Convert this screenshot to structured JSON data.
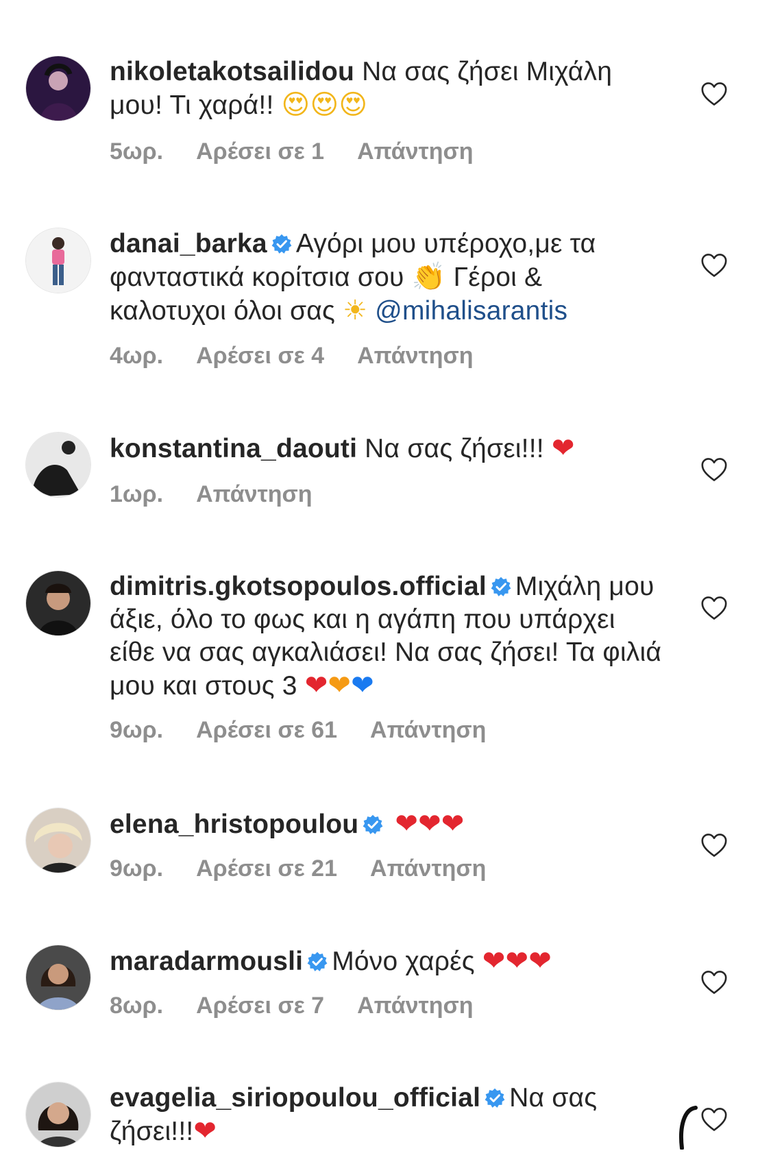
{
  "comments": [
    {
      "username": "nikoletakotsailidou",
      "verified": false,
      "text": " Να σας ζήσει Μιχάλη μου! Τι χαρά!! ",
      "emojis": "😍😍😍",
      "time": "5ωρ.",
      "likes": "Αρέσει σε 1",
      "reply": "Απάντηση"
    },
    {
      "username": "danai_barka",
      "verified": true,
      "text": "Αγόρι μου υπέροχο,με τα φανταστικά κορίτσια σου ",
      "emoji_clap": "👏",
      "text2": " Γέροι & καλοτυχοι όλοι σας ",
      "emoji_sun": "☀",
      "mention": " @mihalisarantis",
      "time": "4ωρ.",
      "likes": "Αρέσει σε 4",
      "reply": "Απάντηση"
    },
    {
      "username": "konstantina_daouti",
      "verified": false,
      "text": " Να σας ζήσει!!! ",
      "emojis": "❤",
      "time": "1ωρ.",
      "reply": "Απάντηση"
    },
    {
      "username": "dimitris.gkotsopoulos.official",
      "verified": true,
      "text": "Μιχάλη μου άξιε, όλο το φως και η αγάπη που υπάρχει είθε να σας αγκαλιάσει! Να σας ζήσει! Τα φιλιά μου και στους 3 ",
      "emoji_red": "❤",
      "emoji_orange": "❤",
      "emoji_blue": "❤",
      "time": "9ωρ.",
      "likes": "Αρέσει σε 61",
      "reply": "Απάντηση"
    },
    {
      "username": "elena_hristopoulou",
      "verified": true,
      "text": " ",
      "emojis": "❤❤❤",
      "time": "9ωρ.",
      "likes": "Αρέσει σε 21",
      "reply": "Απάντηση"
    },
    {
      "username": "maradarmousli",
      "verified": true,
      "text": "Μόνο χαρές ",
      "emojis": "❤❤❤",
      "time": "8ωρ.",
      "likes": "Αρέσει σε 7",
      "reply": "Απάντηση"
    },
    {
      "username": "evagelia_siriopoulou_official",
      "verified": true,
      "text": "Να σας ζήσει!!!",
      "emojis": "❤"
    }
  ],
  "icons": {
    "like": "heart-outline-icon",
    "verified": "verified-badge-icon"
  },
  "colors": {
    "text": "#262626",
    "meta": "#8e8e8e",
    "verified": "#3897f0",
    "mention": "#1f4f8a",
    "heart_emoji": "#e3262f"
  }
}
